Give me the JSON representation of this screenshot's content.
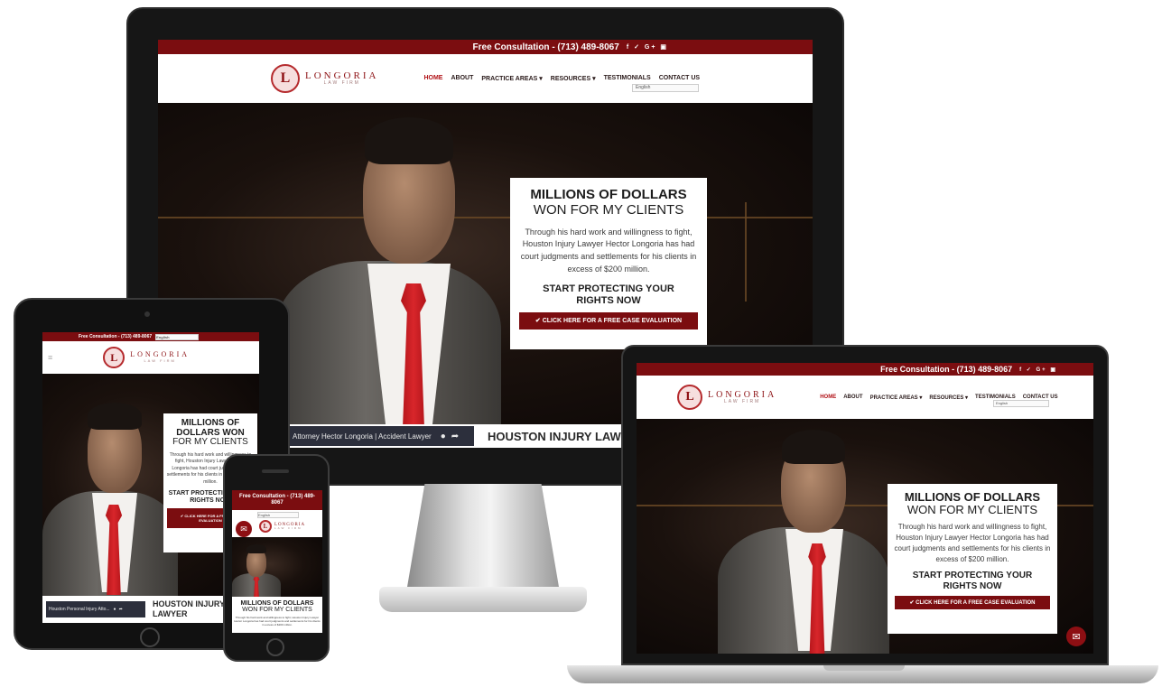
{
  "site": {
    "topbar": {
      "consultation": "Free Consultation - (713) 489-8067",
      "consultation_phone_wrap": "Free Consultation - (713) 489-8067",
      "social_icons": "f ✓ G+ ▣"
    },
    "logo": {
      "mark": "L",
      "name": "LONGORIA",
      "sub": "LAW FIRM"
    },
    "nav": {
      "home": "HOME",
      "about": "ABOUT",
      "practice_areas": "PRACTICE AREAS ▾",
      "resources": "RESOURCES ▾",
      "testimonials": "TESTIMONIALS",
      "contact": "CONTACT US"
    },
    "language": "English",
    "hero": {
      "headline_bold": "MILLIONS OF DOLLARS",
      "headline_rest": "WON FOR MY CLIENTS",
      "headline_tablet_bold_1": "MILLIONS OF",
      "headline_tablet_bold_2": "DOLLARS WON",
      "headline_tablet_rest": "FOR MY CLIENTS",
      "body": "Through his hard work and willingness to fight, Houston Injury Lawyer Hector Longoria has had court judgments and settlements for his clients in excess of $200 million.",
      "subhead": "START PROTECTING YOUR RIGHTS NOW",
      "cta": "✔  CLICK HERE FOR A FREE CASE EVALUATION"
    },
    "video_caption_desktop": "Attorney Hector Longoria | Accident Lawyer",
    "video_caption_tablet": "Houston Personal Injury Atto...",
    "strip_title_desktop": "HOUSTON INJURY LAWYER",
    "strip_title_tablet": "HOUSTON INJURY LAWYER"
  }
}
